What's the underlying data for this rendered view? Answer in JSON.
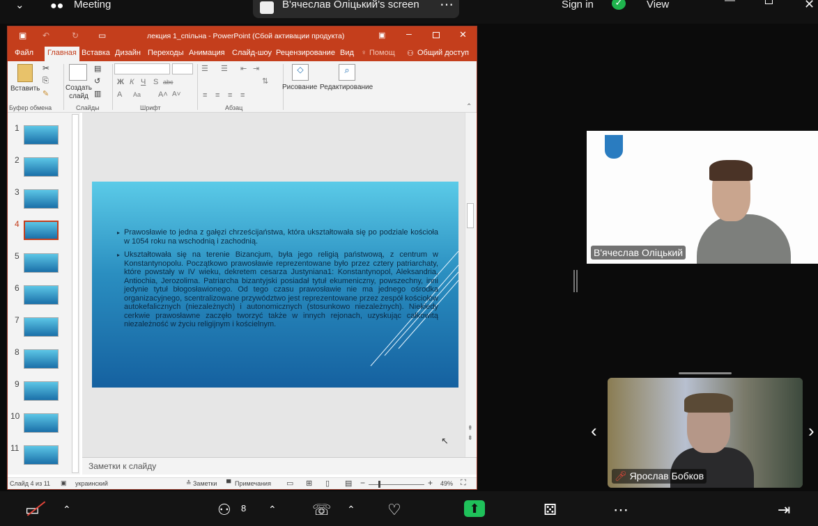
{
  "zoom": {
    "meeting_label": "Meeting",
    "share_label": "В'ячеслав Оліцький's screen",
    "sign_in": "Sign in",
    "view_label": "View",
    "participants_count": "8"
  },
  "ppt": {
    "title": "лекция 1_спільна - PowerPoint (Сбой активации продукта)",
    "tabs": [
      "Файл",
      "Главная",
      "Вставка",
      "Дизайн",
      "Переходы",
      "Анимация",
      "Слайд-шоу",
      "Рецензирование",
      "Вид",
      "Помощ",
      "Общий доступ"
    ],
    "ribbon": {
      "paste": "Вставить",
      "new_slide": "Создать слайд",
      "drawing": "Рисование",
      "editing": "Редактирование",
      "group_clipboard": "Буфер обмена",
      "group_slides": "Слайды",
      "group_font": "Шрифт",
      "group_paragraph": "Абзац"
    },
    "thumb_numbers": [
      "1",
      "2",
      "3",
      "4",
      "5",
      "6",
      "7",
      "8",
      "9",
      "10",
      "11"
    ],
    "slide": {
      "bullet1": "Prawosławie to jedna z gałęzi chrześcijaństwa, która ukształtowała się po podziale kościoła w 1054 roku na wschodnią i zachodnią.",
      "bullet2": "Ukształtowała się na terenie Bizancjum, była jego religią państwową, z centrum w Konstantynopolu. Początkowo prawosławie reprezentowane było przez cztery patriarchaty, które powstały w IV wieku, dekretem cesarza Justyniana1: Konstantynopol, Aleksandria, Antiochia, Jerozolima. Patriarcha bizantyjski posiadał tytuł ekumeniczny, powszechny, inni jedynie tytuł błogosławionego. Od tego czasu prawosławie nie ma jednego ośrodka organizacyjnego, scentralizowane przywództwo jest reprezentowane przez zespół kościołów autokefalicznych (niezależnych) i autonomicznych (stosunkowo niezależnych). Niekiedy cerkwie prawosławne zaczęło tworzyć także w innych rejonach, uzyskując całkowitą niezależność w życiu religijnym i kościelnym."
    },
    "notes_placeholder": "Заметки к слайду",
    "status": {
      "slide_info": "Слайд 4 из 11",
      "language": "украинский",
      "notes": "Заметки",
      "comments": "Примечания",
      "zoom": "49%"
    }
  },
  "participants": {
    "p1_name": "В'ячеслав Оліцький",
    "p2_name": "Ярослав Бобков"
  }
}
